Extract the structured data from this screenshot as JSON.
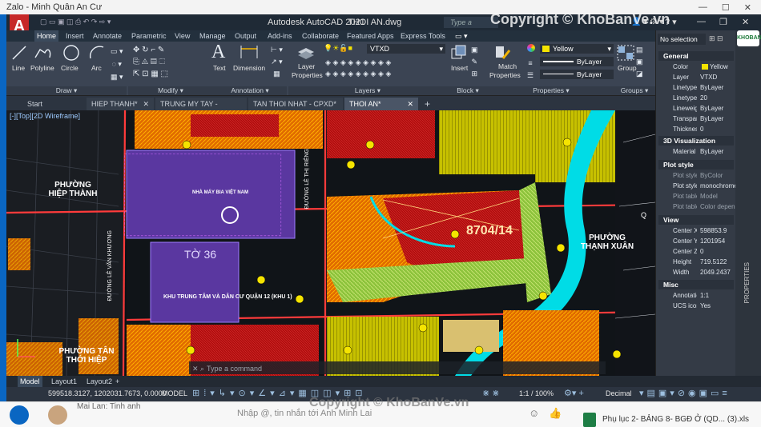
{
  "zalo": {
    "window_title": "Zalo - Minh Quân An Cư",
    "chat_sender": "Mai Lan: Tinh anh",
    "message_placeholder": "Nhập @, tin nhắn tới Anh Minh Lai",
    "attachment_file": "Phụ lục 2- BẢNG 8- BGĐ Ở (QD... (3).xls"
  },
  "acad": {
    "app_title": "Autodesk AutoCAD 2021",
    "file_name": "THOI AN.dwg",
    "search_placeholder": "Type a keyword",
    "ribbon_tabs": [
      "Home",
      "Insert",
      "Annotate",
      "Parametric",
      "View",
      "Manage",
      "Output",
      "Add-ins",
      "Collaborate",
      "Featured Apps",
      "Express Tools"
    ],
    "active_ribbon_tab": "Home",
    "ribbon": {
      "draw_tools": [
        "Line",
        "Polyline",
        "Circle",
        "Arc"
      ],
      "draw_panel": "Draw",
      "modify_panel": "Modify",
      "annotation_tools": [
        "Text",
        "Dimension"
      ],
      "annotation_panel": "Annotation",
      "layer_properties": "Layer Properties",
      "layers_panel": "Layers",
      "current_layer": "VTXD",
      "insert": "Insert",
      "block_panel": "Block",
      "match_properties": "Match Properties",
      "properties_panel": "Properties",
      "color_value": "Yellow",
      "linetype_value": "ByLayer",
      "lineweight_value": "ByLayer",
      "group": "Group",
      "groups_panel": "Groups"
    },
    "doc_tabs": [
      "Start",
      "HIEP THANH*",
      "TRUNG MY TAY - CPXD*",
      "TAN THOI NHAT - CPXD*",
      "THOI AN*"
    ],
    "active_doc_tab": "THOI AN*",
    "viewport_label": "[-][Top][2D Wireframe]",
    "command_placeholder": "Type a command",
    "map_labels": {
      "ward_hiep_thanh": "PHƯỜNG HIỆP THÀNH",
      "ward_thanh_xuan": "PHƯỜNG THẠNH XUÂN",
      "ward_tan_thoi_hiep": "PHƯỜNG TÂN THỚI HIỆP",
      "street_le_thi_rieng": "ĐƯỜNG LÊ THỊ RIÊNG",
      "street_le_van_khuong": "ĐƯỜNG LÊ VĂN KHƯƠNG",
      "factory": "NHÀ MÁY BIA VIỆT NAM",
      "block_to36": "TỜ 36",
      "lot_code": "8704/14",
      "area_label": "KHU TRUNG TÂM VÀ DÂN CƯ QUẬN 12 (KHU 1)"
    },
    "layout_tabs": [
      "Model",
      "Layout1",
      "Layout2"
    ],
    "active_layout": "Model",
    "coordinates": "599518.3127, 1202031.7673, 0.0000",
    "space": "MODEL",
    "scale": "1:1 / 100%",
    "units": "Decimal",
    "properties_panel": {
      "no_selection": "No selection",
      "sections": [
        {
          "title": "General",
          "rows": [
            {
              "key": "Color",
              "value": "Yellow"
            },
            {
              "key": "Layer",
              "value": "VTXD"
            },
            {
              "key": "Linetype",
              "value": "ByLayer"
            },
            {
              "key": "Linetype scale",
              "value": "20"
            },
            {
              "key": "Lineweight",
              "value": "ByLayer"
            },
            {
              "key": "Transparency",
              "value": "ByLayer"
            },
            {
              "key": "Thickness",
              "value": "0"
            }
          ]
        },
        {
          "title": "3D Visualization",
          "rows": [
            {
              "key": "Material",
              "value": "ByLayer"
            }
          ]
        },
        {
          "title": "Plot style",
          "rows": [
            {
              "key": "Plot style",
              "value": "ByColor"
            },
            {
              "key": "Plot style table",
              "value": "monochrome"
            },
            {
              "key": "Plot table attached to",
              "value": "Model"
            },
            {
              "key": "Plot table type",
              "value": "Color dependent"
            }
          ]
        },
        {
          "title": "View",
          "rows": [
            {
              "key": "Center X",
              "value": "598853.9"
            },
            {
              "key": "Center Y",
              "value": "1201954"
            },
            {
              "key": "Center Z",
              "value": "0"
            },
            {
              "key": "Height",
              "value": "719.5122"
            },
            {
              "key": "Width",
              "value": "2049.2437"
            }
          ]
        },
        {
          "title": "Misc",
          "rows": [
            {
              "key": "Annotation scale",
              "value": "1:1"
            },
            {
              "key": "UCS icon On",
              "value": "Yes"
            }
          ]
        }
      ],
      "side_label": "PROPERTIES"
    }
  },
  "watermark": "Copyright © KhoBanVe.vn",
  "logo_text": "KHOBANVE",
  "colors": {
    "autocad_red": "#d22a2a",
    "zalo_blue": "#0a66c2",
    "layer_yellow": "#f5e400",
    "parcel_red": "#b00d0d",
    "river_cyan": "#00e0e8"
  }
}
